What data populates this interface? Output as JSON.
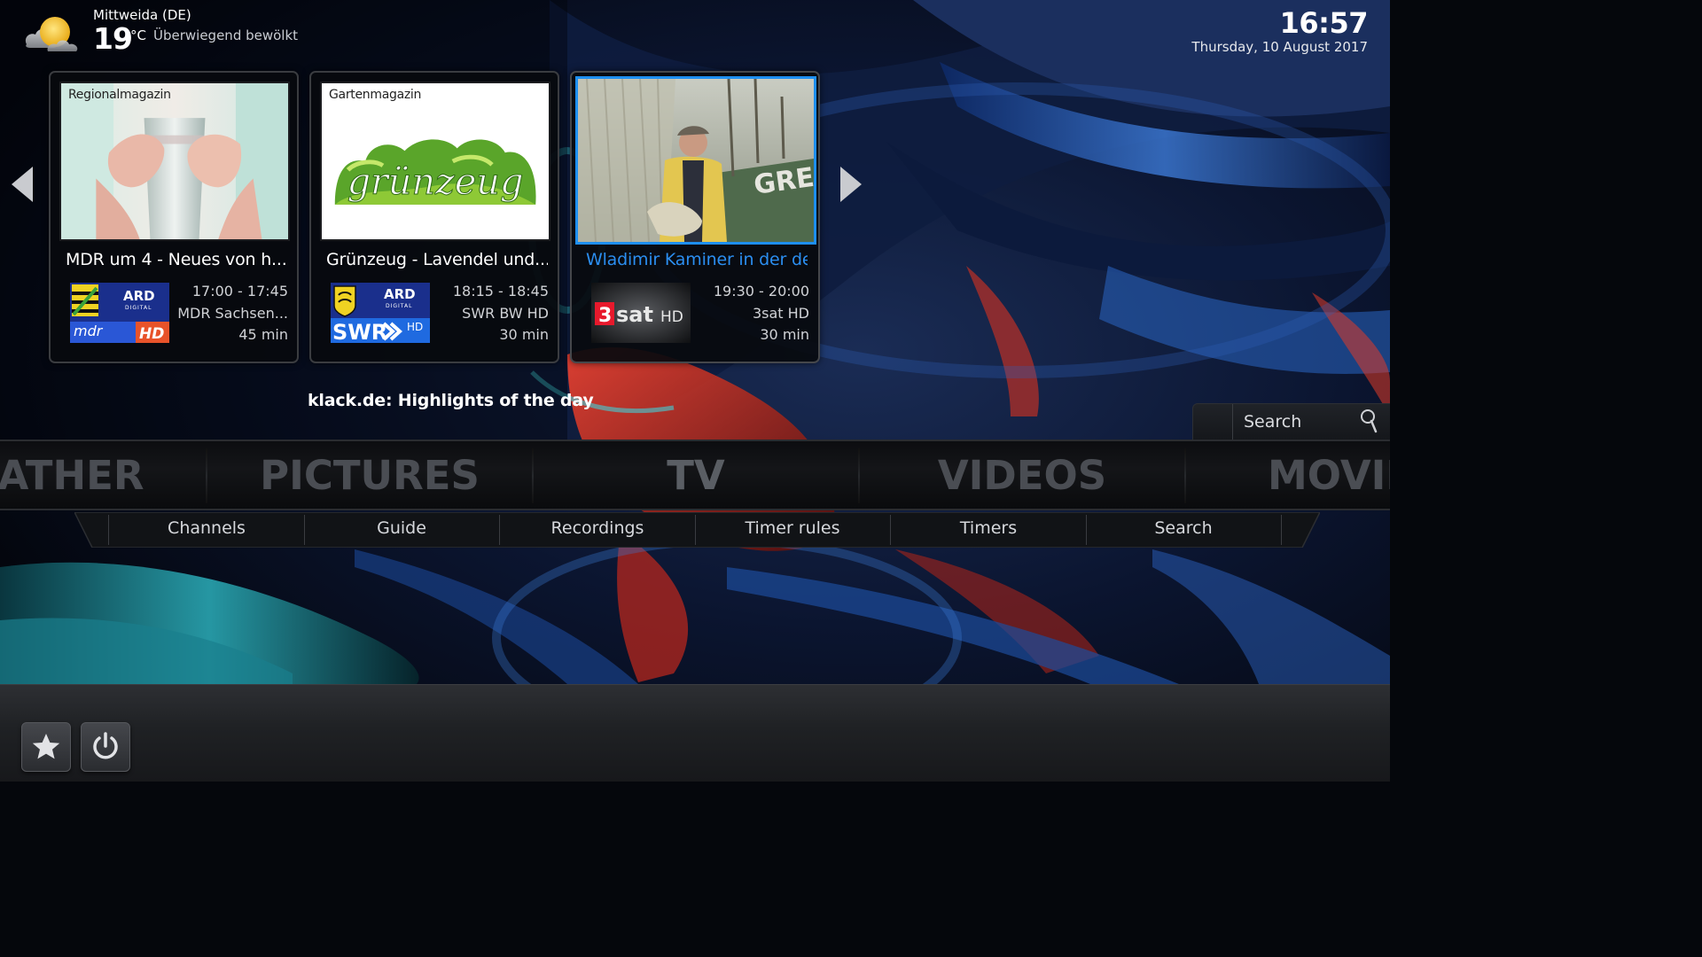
{
  "weather": {
    "location": "Mittweida (DE)",
    "temperature": "19",
    "unit": "°C",
    "condition": "Überwiegend bewölkt",
    "icon": "partly-cloudy-sun-icon"
  },
  "clock": {
    "time": "16:57",
    "date": "Thursday, 10 August 2017"
  },
  "spotlight": {
    "title": "klack.de: Highlights of the day",
    "items": [
      {
        "caption": "Regionalmagazin",
        "title": "MDR um 4 - Neues von h...",
        "channel_logo": "mdr-sachsen-hd-logo",
        "channel_logo_text": [
          "ARD",
          "DIGITAL",
          "mdr",
          "HD"
        ],
        "time": "17:00 - 17:45",
        "channel": "MDR Sachsen...",
        "duration": "45 min"
      },
      {
        "caption": "Gartenmagazin",
        "thumb_text": "grünzeug",
        "title": "Grünzeug - Lavendel und...",
        "channel_logo": "swr-bw-hd-logo",
        "channel_logo_text": [
          "ARD",
          "DIGITAL",
          "SWR",
          "HD"
        ],
        "time": "18:15 - 18:45",
        "channel": "SWR BW HD",
        "duration": "30 min"
      },
      {
        "caption": "",
        "thumb_text": "GRE",
        "title": "Wladimir Kaminer in der de",
        "channel_logo": "3sat-hd-logo",
        "channel_logo_text": [
          "3",
          "sat",
          "HD"
        ],
        "time": "19:30 - 20:00",
        "channel": "3sat HD",
        "duration": "30 min",
        "selected": true
      }
    ]
  },
  "search": {
    "label": "Search"
  },
  "main_menu": {
    "items": [
      "ATHER",
      "PICTURES",
      "TV",
      "VIDEOS",
      "MOVIE"
    ],
    "active": "TV"
  },
  "submenu": {
    "items": [
      "Channels",
      "Guide",
      "Recordings",
      "Timer rules",
      "Timers",
      "Search"
    ]
  },
  "bottom_bar": {
    "buttons": [
      {
        "name": "favourites",
        "icon": "star-icon"
      },
      {
        "name": "power",
        "icon": "power-icon"
      }
    ]
  },
  "colors": {
    "accent": "#1e8ff0",
    "menu_text": "#4a4d53",
    "card_bg": "#08090c"
  }
}
